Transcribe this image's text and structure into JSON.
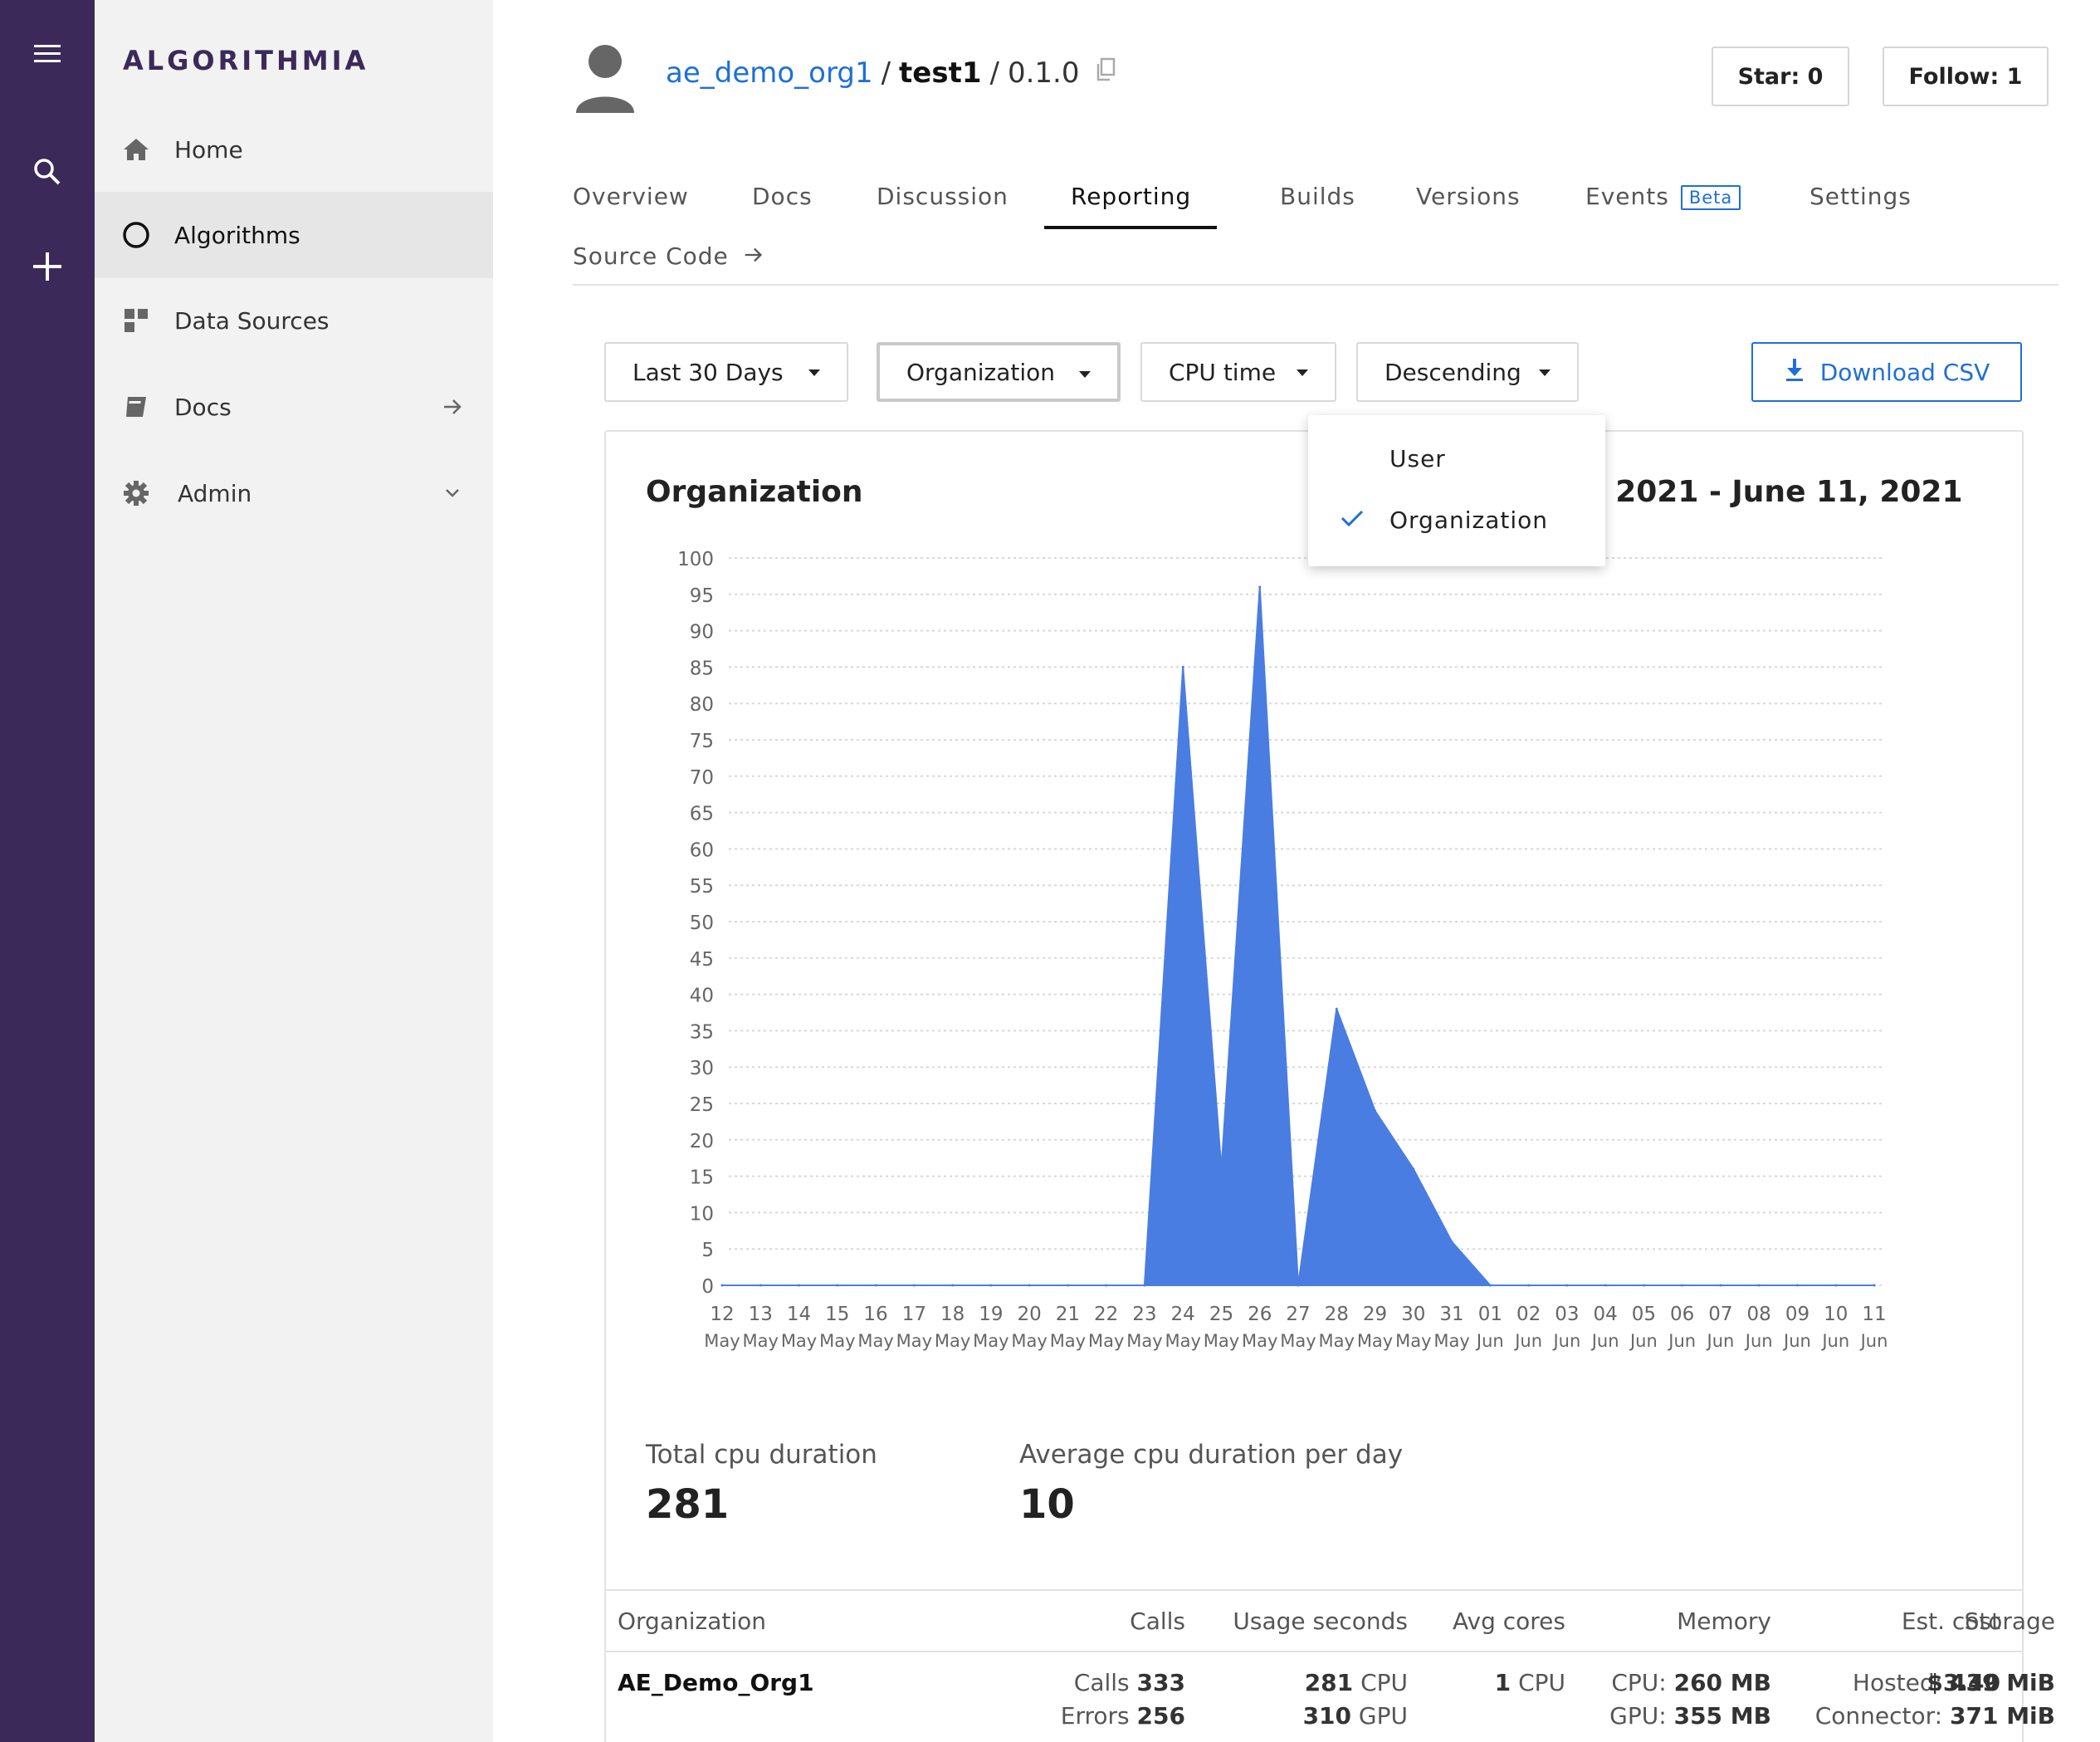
{
  "brand": {
    "logo_text": "ALGORITHMIA",
    "rail_bg": "#3b2a59",
    "accent": "#1e6fd9"
  },
  "rail": {
    "icons": [
      "menu-icon",
      "search-icon",
      "plus-icon"
    ]
  },
  "sidebar": {
    "items": [
      {
        "label": "Home",
        "icon": "home-icon",
        "active": false
      },
      {
        "label": "Algorithms",
        "icon": "circle-icon",
        "active": true
      },
      {
        "label": "Data Sources",
        "icon": "grid-icon",
        "active": false
      },
      {
        "label": "Docs",
        "icon": "book-icon",
        "trail": "arrow-right-icon",
        "active": false
      },
      {
        "label": "Admin",
        "icon": "gear-icon",
        "trail": "chevron-down-icon",
        "active": false
      }
    ]
  },
  "header": {
    "org": "ae_demo_org1",
    "sep1": "/",
    "algo": "test1",
    "sep2": "/",
    "version": "0.1.0",
    "star_label": "Star: 0",
    "follow_label": "Follow: 1"
  },
  "tabs": [
    {
      "label": "Overview"
    },
    {
      "label": "Docs"
    },
    {
      "label": "Discussion"
    },
    {
      "label": "Reporting",
      "active": true
    },
    {
      "label": "Builds"
    },
    {
      "label": "Versions"
    },
    {
      "label": "Events",
      "badge": "Beta"
    },
    {
      "label": "Settings"
    },
    {
      "label": "Source Code",
      "icon": "arrow-right-icon"
    }
  ],
  "filters": {
    "range": "Last 30 Days",
    "group_by": "Organization",
    "metric": "CPU time",
    "order": "Descending",
    "download": "Download CSV"
  },
  "dropdown": {
    "options": [
      {
        "label": "User",
        "selected": false
      },
      {
        "label": "Organization",
        "selected": true
      }
    ]
  },
  "report": {
    "title_left": "Organization",
    "title_right": ", 2021 - June 11, 2021"
  },
  "chart_data": {
    "type": "area",
    "title": "",
    "xlabel": "",
    "ylabel": "",
    "ylim": [
      0,
      100
    ],
    "yticks": [
      0,
      5,
      10,
      15,
      20,
      25,
      30,
      35,
      40,
      45,
      50,
      55,
      60,
      65,
      70,
      75,
      80,
      85,
      90,
      95,
      100
    ],
    "grid": true,
    "color": "#4a7de2",
    "categories": [
      [
        "12",
        "May"
      ],
      [
        "13",
        "May"
      ],
      [
        "14",
        "May"
      ],
      [
        "15",
        "May"
      ],
      [
        "16",
        "May"
      ],
      [
        "17",
        "May"
      ],
      [
        "18",
        "May"
      ],
      [
        "19",
        "May"
      ],
      [
        "20",
        "May"
      ],
      [
        "21",
        "May"
      ],
      [
        "22",
        "May"
      ],
      [
        "23",
        "May"
      ],
      [
        "24",
        "May"
      ],
      [
        "25",
        "May"
      ],
      [
        "26",
        "May"
      ],
      [
        "27",
        "May"
      ],
      [
        "28",
        "May"
      ],
      [
        "29",
        "May"
      ],
      [
        "30",
        "May"
      ],
      [
        "31",
        "May"
      ],
      [
        "01",
        "Jun"
      ],
      [
        "02",
        "Jun"
      ],
      [
        "03",
        "Jun"
      ],
      [
        "04",
        "Jun"
      ],
      [
        "05",
        "Jun"
      ],
      [
        "06",
        "Jun"
      ],
      [
        "07",
        "Jun"
      ],
      [
        "08",
        "Jun"
      ],
      [
        "09",
        "Jun"
      ],
      [
        "10",
        "Jun"
      ],
      [
        "11",
        "Jun"
      ]
    ],
    "values": [
      0,
      0,
      0,
      0,
      0,
      0,
      0,
      0,
      0,
      0,
      0,
      0,
      85,
      16,
      96,
      0,
      38,
      24,
      16,
      6,
      0,
      0,
      0,
      0,
      0,
      0,
      0,
      0,
      0,
      0,
      0
    ]
  },
  "stats": {
    "total_label": "Total cpu duration",
    "total_value": "281",
    "avg_label": "Average cpu duration per day",
    "avg_value": "10"
  },
  "table": {
    "headers": [
      "Organization",
      "Calls",
      "Usage seconds",
      "Avg cores",
      "Memory",
      "Storage",
      "Est. cost"
    ],
    "row": {
      "org": "AE_Demo_Org1",
      "calls_label": "Calls",
      "calls": "333",
      "errors_label": "Errors",
      "errors": "256",
      "cpu_sec": "281",
      "cpu_unit": "CPU",
      "gpu_sec": "310",
      "gpu_unit": "GPU",
      "avg_cores": "1",
      "avg_cores_unit": "CPU",
      "mem_cpu_label": "CPU:",
      "mem_cpu": "260 MB",
      "mem_gpu_label": "GPU:",
      "mem_gpu": "355 MB",
      "hosted_label": "Hosted:",
      "hosted": "439 MiB",
      "connector_label": "Connector:",
      "connector": "371 MiB",
      "cost": "$3.40"
    }
  }
}
